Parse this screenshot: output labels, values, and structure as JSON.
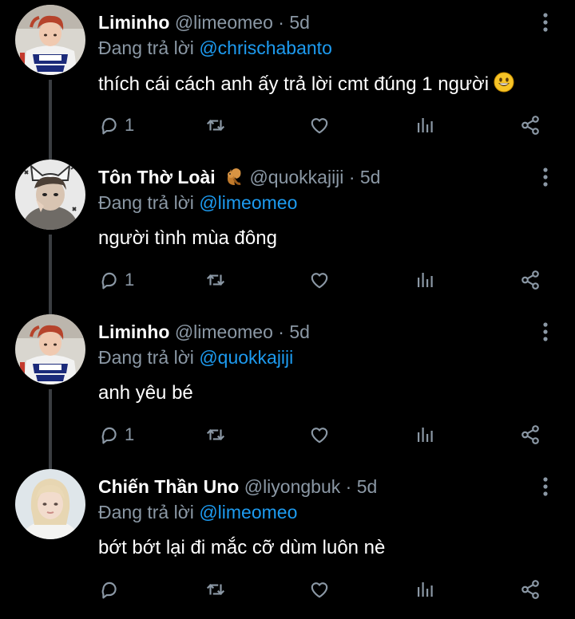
{
  "replying_prefix": "Đang trả lời",
  "tweets": [
    {
      "name": "Liminho",
      "handle": "@limeomeo",
      "dot": "·",
      "time": "5d",
      "reply_to": "@chrischabanto",
      "text": "thích cái cách anh ấy trả lời cmt đúng 1 người",
      "trailing_emoji": "grinning-face-emoji",
      "reply_count": "1",
      "avatar": "photo-avatar-racer"
    },
    {
      "name": "Tôn Thờ Loài",
      "name_emoji": "squirrel-emoji",
      "handle": "@quokkajiji",
      "dot": "·",
      "time": "5d",
      "reply_to": "@limeomeo",
      "text": "người tình mùa đông",
      "reply_count": "1",
      "avatar": "photo-avatar-sketch"
    },
    {
      "name": "Liminho",
      "handle": "@limeomeo",
      "dot": "·",
      "time": "5d",
      "reply_to": "@quokkajiji",
      "text": "anh yêu bé",
      "reply_count": "1",
      "avatar": "photo-avatar-racer"
    },
    {
      "name": "Chiến Thần Uno",
      "handle": "@liyongbuk",
      "dot": "·",
      "time": "5d",
      "reply_to": "@limeomeo",
      "text": "bớt bớt lại đi mắc cỡ dùm luôn nè",
      "reply_count": "",
      "avatar": "photo-avatar-blonde"
    }
  ],
  "colors": {
    "background": "#000000",
    "text": "#ffffff",
    "muted": "#8b98a5",
    "accent": "#1d9bf0",
    "thread_line": "#3a3d41"
  }
}
